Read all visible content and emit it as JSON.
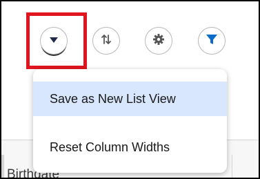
{
  "toolbar": {
    "buttons": [
      {
        "name": "list-view-controls",
        "icon": "caret-down-icon"
      },
      {
        "name": "sort",
        "icon": "sort-arrows-icon"
      },
      {
        "name": "settings",
        "icon": "gear-icon"
      },
      {
        "name": "filter",
        "icon": "filter-icon"
      }
    ]
  },
  "menu": {
    "items": [
      {
        "label": "Save as New List View"
      },
      {
        "label": "Reset Column Widths"
      }
    ]
  },
  "table": {
    "column_header": "Birthdate"
  },
  "colors": {
    "highlight": "#e0151f",
    "filter_accent": "#0b6bcb",
    "caret": "#1f2a4a",
    "menu_active_bg": "#d8e6fe"
  }
}
